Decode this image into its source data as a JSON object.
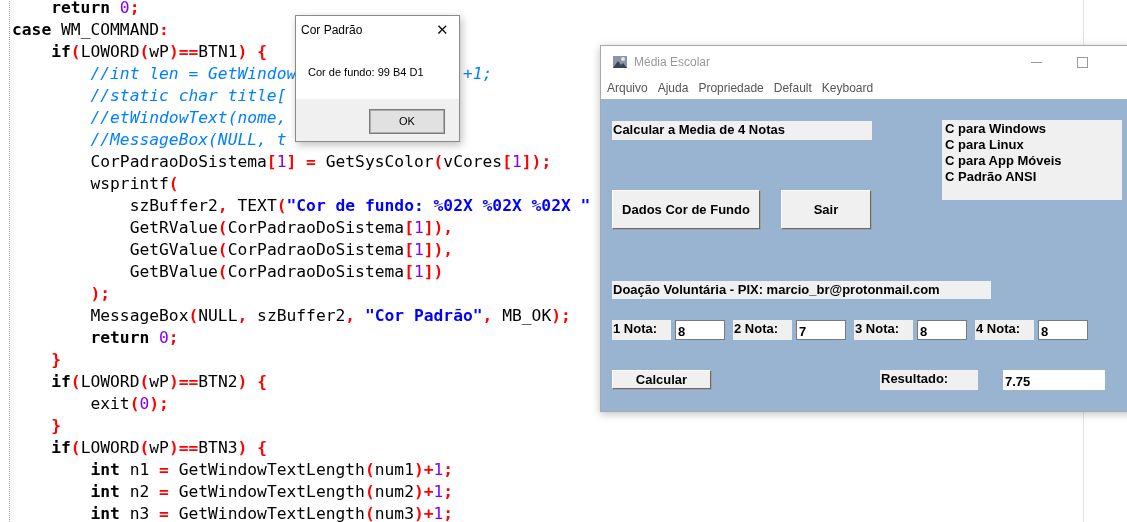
{
  "editor": {
    "lines": [
      {
        "tokens": [
          {
            "kind": "keyword",
            "text": "    return"
          },
          {
            "kind": "number",
            "text": " 0"
          },
          {
            "kind": "punct",
            "text": ";"
          }
        ]
      },
      {
        "tokens": [
          {
            "kind": "keyword",
            "text": "case"
          },
          {
            "kind": "plain",
            "text": " WM_COMMAND"
          },
          {
            "kind": "punct",
            "text": ":"
          }
        ]
      },
      {
        "tokens": [
          {
            "kind": "keyword",
            "text": "    if"
          },
          {
            "kind": "punct",
            "text": "("
          },
          {
            "kind": "plain",
            "text": "LOWORD"
          },
          {
            "kind": "punct",
            "text": "("
          },
          {
            "kind": "plain",
            "text": "wP"
          },
          {
            "kind": "punct",
            "text": ")=="
          },
          {
            "kind": "plain",
            "text": "BTN1"
          },
          {
            "kind": "punct",
            "text": ")"
          },
          {
            "kind": "punct",
            "text": " {"
          }
        ]
      },
      {
        "tokens": [
          {
            "kind": "comment",
            "text": "        //int len = GetWindow"
          }
        ],
        "after_dialog": [
          {
            "kind": "comment",
            "text": "+1;"
          }
        ]
      },
      {
        "tokens": [
          {
            "kind": "comment",
            "text": "        //static char title["
          }
        ]
      },
      {
        "tokens": [
          {
            "kind": "comment",
            "text": "        //etWindowText(nome,"
          }
        ]
      },
      {
        "tokens": [
          {
            "kind": "comment",
            "text": "        //MessageBox(NULL, t"
          }
        ]
      },
      {
        "tokens": [
          {
            "kind": "plain",
            "text": "        CorPadraoDoSistema"
          },
          {
            "kind": "punct",
            "text": "["
          },
          {
            "kind": "number",
            "text": "1"
          },
          {
            "kind": "punct",
            "text": "]"
          },
          {
            "kind": "punct",
            "text": " ="
          },
          {
            "kind": "plain",
            "text": " GetSysColor"
          },
          {
            "kind": "punct",
            "text": "("
          },
          {
            "kind": "plain",
            "text": "vCores"
          },
          {
            "kind": "punct",
            "text": "["
          },
          {
            "kind": "number",
            "text": "1"
          },
          {
            "kind": "punct",
            "text": "]);"
          }
        ]
      },
      {
        "tokens": [
          {
            "kind": "plain",
            "text": "        wsprintf"
          },
          {
            "kind": "punct",
            "text": "("
          }
        ]
      },
      {
        "tokens": [
          {
            "kind": "plain",
            "text": "            szBuffer2"
          },
          {
            "kind": "punct",
            "text": ","
          },
          {
            "kind": "plain",
            "text": " TEXT"
          },
          {
            "kind": "punct",
            "text": "("
          },
          {
            "kind": "string",
            "text": "\"Cor de fundo: %02X %02X %02X \""
          }
        ]
      },
      {
        "tokens": [
          {
            "kind": "plain",
            "text": "            GetRValue"
          },
          {
            "kind": "punct",
            "text": "("
          },
          {
            "kind": "plain",
            "text": "CorPadraoDoSistema"
          },
          {
            "kind": "punct",
            "text": "["
          },
          {
            "kind": "number",
            "text": "1"
          },
          {
            "kind": "punct",
            "text": "]),"
          }
        ]
      },
      {
        "tokens": [
          {
            "kind": "plain",
            "text": "            GetGValue"
          },
          {
            "kind": "punct",
            "text": "("
          },
          {
            "kind": "plain",
            "text": "CorPadraoDoSistema"
          },
          {
            "kind": "punct",
            "text": "["
          },
          {
            "kind": "number",
            "text": "1"
          },
          {
            "kind": "punct",
            "text": "]),"
          }
        ]
      },
      {
        "tokens": [
          {
            "kind": "plain",
            "text": "            GetBValue"
          },
          {
            "kind": "punct",
            "text": "("
          },
          {
            "kind": "plain",
            "text": "CorPadraoDoSistema"
          },
          {
            "kind": "punct",
            "text": "["
          },
          {
            "kind": "number",
            "text": "1"
          },
          {
            "kind": "punct",
            "text": "])"
          }
        ]
      },
      {
        "tokens": [
          {
            "kind": "punct",
            "text": "        );"
          }
        ]
      },
      {
        "tokens": [
          {
            "kind": "plain",
            "text": "        MessageBox"
          },
          {
            "kind": "punct",
            "text": "("
          },
          {
            "kind": "plain",
            "text": "NULL"
          },
          {
            "kind": "punct",
            "text": ","
          },
          {
            "kind": "plain",
            "text": " szBuffer2"
          },
          {
            "kind": "punct",
            "text": ","
          },
          {
            "kind": "string",
            "text": " \"Cor Padrão\""
          },
          {
            "kind": "punct",
            "text": ","
          },
          {
            "kind": "plain",
            "text": " MB_OK"
          },
          {
            "kind": "punct",
            "text": ");"
          }
        ]
      },
      {
        "tokens": [
          {
            "kind": "keyword",
            "text": "        return"
          },
          {
            "kind": "number",
            "text": " 0"
          },
          {
            "kind": "punct",
            "text": ";"
          }
        ]
      },
      {
        "tokens": [
          {
            "kind": "punct",
            "text": "    }"
          }
        ]
      },
      {
        "tokens": [
          {
            "kind": "keyword",
            "text": "    if"
          },
          {
            "kind": "punct",
            "text": "("
          },
          {
            "kind": "plain",
            "text": "LOWORD"
          },
          {
            "kind": "punct",
            "text": "("
          },
          {
            "kind": "plain",
            "text": "wP"
          },
          {
            "kind": "punct",
            "text": ")=="
          },
          {
            "kind": "plain",
            "text": "BTN2"
          },
          {
            "kind": "punct",
            "text": ")"
          },
          {
            "kind": "punct",
            "text": " {"
          }
        ]
      },
      {
        "tokens": [
          {
            "kind": "plain",
            "text": "        exit"
          },
          {
            "kind": "punct",
            "text": "("
          },
          {
            "kind": "number",
            "text": "0"
          },
          {
            "kind": "punct",
            "text": ");"
          }
        ]
      },
      {
        "tokens": [
          {
            "kind": "punct",
            "text": "    }"
          }
        ]
      },
      {
        "tokens": [
          {
            "kind": "keyword",
            "text": "    if"
          },
          {
            "kind": "punct",
            "text": "("
          },
          {
            "kind": "plain",
            "text": "LOWORD"
          },
          {
            "kind": "punct",
            "text": "("
          },
          {
            "kind": "plain",
            "text": "wP"
          },
          {
            "kind": "punct",
            "text": ")=="
          },
          {
            "kind": "plain",
            "text": "BTN3"
          },
          {
            "kind": "punct",
            "text": ")"
          },
          {
            "kind": "punct",
            "text": " {"
          }
        ]
      },
      {
        "tokens": [
          {
            "kind": "keyword",
            "text": "        int"
          },
          {
            "kind": "plain",
            "text": " n1"
          },
          {
            "kind": "punct",
            "text": " ="
          },
          {
            "kind": "plain",
            "text": " GetWindowTextLength"
          },
          {
            "kind": "punct",
            "text": "("
          },
          {
            "kind": "plain",
            "text": "num1"
          },
          {
            "kind": "punct",
            "text": ")+"
          },
          {
            "kind": "number",
            "text": "1"
          },
          {
            "kind": "punct",
            "text": ";"
          }
        ]
      },
      {
        "tokens": [
          {
            "kind": "keyword",
            "text": "        int"
          },
          {
            "kind": "plain",
            "text": " n2"
          },
          {
            "kind": "punct",
            "text": " ="
          },
          {
            "kind": "plain",
            "text": " GetWindowTextLength"
          },
          {
            "kind": "punct",
            "text": "("
          },
          {
            "kind": "plain",
            "text": "num2"
          },
          {
            "kind": "punct",
            "text": ")+"
          },
          {
            "kind": "number",
            "text": "1"
          },
          {
            "kind": "punct",
            "text": ";"
          }
        ]
      },
      {
        "tokens": [
          {
            "kind": "keyword",
            "text": "        int"
          },
          {
            "kind": "plain",
            "text": " n3"
          },
          {
            "kind": "punct",
            "text": " ="
          },
          {
            "kind": "plain",
            "text": " GetWindowTextLength"
          },
          {
            "kind": "punct",
            "text": "("
          },
          {
            "kind": "plain",
            "text": "num3"
          },
          {
            "kind": "punct",
            "text": ")+"
          },
          {
            "kind": "number",
            "text": "1"
          },
          {
            "kind": "punct",
            "text": ";"
          }
        ]
      }
    ]
  },
  "message_box": {
    "title": "Cor Padrão",
    "close": "✕",
    "message": "Cor de fundo: 99 B4 D1",
    "button": "OK"
  },
  "app_window": {
    "title": "Média Escolar",
    "active": false,
    "menu": [
      "Arquivo",
      "Ajuda",
      "Propriedade",
      "Default",
      "Keyboard"
    ],
    "heading": "Calcular a Media de 4 Notas",
    "listbox": [
      "C para Windows",
      "C para Linux",
      "C para App Móveis",
      "C Padrão ANSI"
    ],
    "buttons": [
      "Dados Cor de Fundo",
      "Sair"
    ],
    "donation": "Doação Voluntária - PIX: marcio_br@protonmail.com",
    "notes": [
      {
        "label": "1 Nota:",
        "value": "8"
      },
      {
        "label": "2 Nota:",
        "value": "7"
      },
      {
        "label": "3 Nota:",
        "value": "8"
      },
      {
        "label": "4 Nota:",
        "value": "8"
      }
    ],
    "calculate_button": "Calcular",
    "result_label": "Resultado:",
    "result_value": "7.75"
  }
}
